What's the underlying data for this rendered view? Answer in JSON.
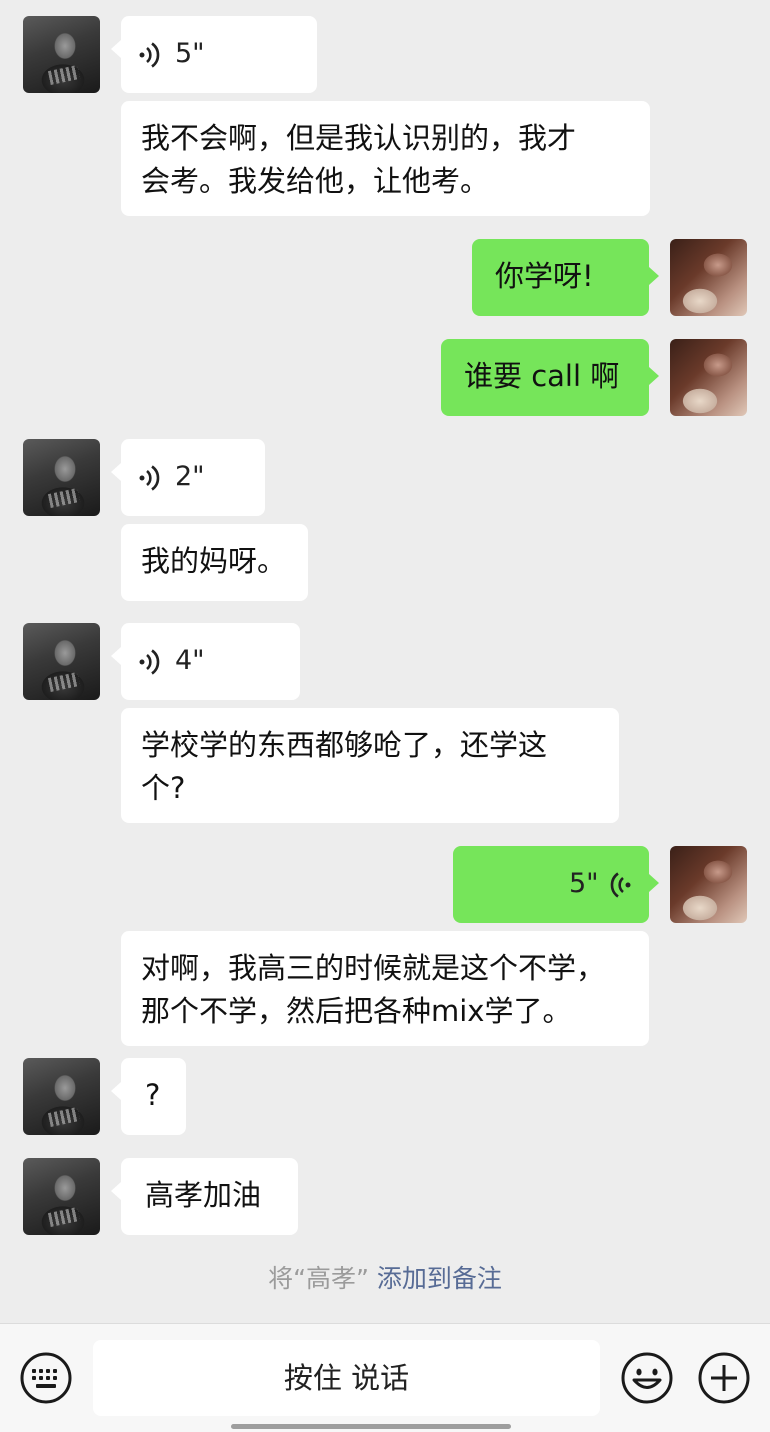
{
  "messages": [
    {
      "side": "left",
      "kind": "voice",
      "duration": "5\""
    },
    {
      "side": "left",
      "kind": "text",
      "lines": [
        "我不会啊，但是我认识别的，我才",
        "会考。我发给他，让他考。"
      ]
    },
    {
      "side": "right",
      "kind": "text",
      "lines": [
        "你学呀!"
      ]
    },
    {
      "side": "right",
      "kind": "text",
      "lines": [
        "谁要 call 啊"
      ]
    },
    {
      "side": "left",
      "kind": "voice",
      "duration": "2\""
    },
    {
      "side": "left",
      "kind": "text",
      "lines": [
        "我的妈呀。"
      ]
    },
    {
      "side": "left",
      "kind": "voice",
      "duration": "4\""
    },
    {
      "side": "left",
      "kind": "text",
      "lines": [
        "学校学的东西都够呛了，还学这",
        "个?"
      ]
    },
    {
      "side": "right",
      "kind": "voice",
      "duration": "5\""
    },
    {
      "side": "left",
      "kind": "text",
      "lines": [
        "对啊，我高三的时候就是这个不学，",
        "那个不学，然后把各种mix学了。"
      ]
    },
    {
      "side": "left",
      "kind": "text",
      "lines": [
        "?"
      ]
    },
    {
      "side": "left",
      "kind": "text",
      "lines": [
        "高孝加油"
      ]
    }
  ],
  "system_notice": {
    "prefix": "将“高孝”",
    "link": "添加到备注"
  },
  "input_bar": {
    "hold_to_talk": "按住 说话",
    "left_icon": "keyboard-icon",
    "emoji_icon": "emoji-icon",
    "plus_icon": "plus-icon"
  },
  "colors": {
    "background": "#ededed",
    "incoming_bubble": "#ffffff",
    "outgoing_bubble": "#76e55a",
    "link": "#576b95",
    "system_text": "#9b9b9b"
  }
}
